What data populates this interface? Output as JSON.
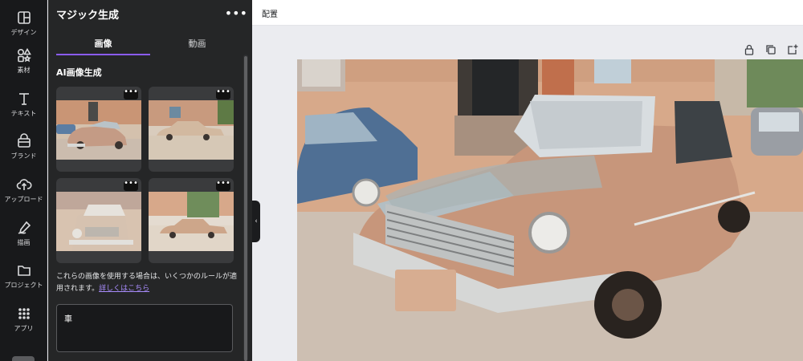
{
  "rail": {
    "items": [
      {
        "label": "デザイン",
        "icon": "layout-icon"
      },
      {
        "label": "素材",
        "icon": "shapes-icon"
      },
      {
        "label": "テキスト",
        "icon": "text-icon"
      },
      {
        "label": "ブランド",
        "icon": "brand-icon"
      },
      {
        "label": "アップロード",
        "icon": "cloud-upload-icon"
      },
      {
        "label": "描画",
        "icon": "draw-icon"
      },
      {
        "label": "プロジェクト",
        "icon": "folder-icon"
      },
      {
        "label": "アプリ",
        "icon": "apps-grid-icon"
      }
    ]
  },
  "panel": {
    "title": "マジック生成",
    "more": "•••",
    "tabs": [
      "画像",
      "動画"
    ],
    "section_title": "AI画像生成",
    "thumb_more": "•••",
    "notice_text": "これらの画像を使用する場合は、いくつかのルールが適用されます。",
    "notice_link": "詳しくはこちら",
    "prompt_value": "車"
  },
  "topbar": {
    "arrange_label": "配置"
  },
  "colors": {
    "accent": "#8b5cf6",
    "link": "#a78bfa",
    "rail_bg": "#18191b",
    "panel_bg": "#252627"
  }
}
